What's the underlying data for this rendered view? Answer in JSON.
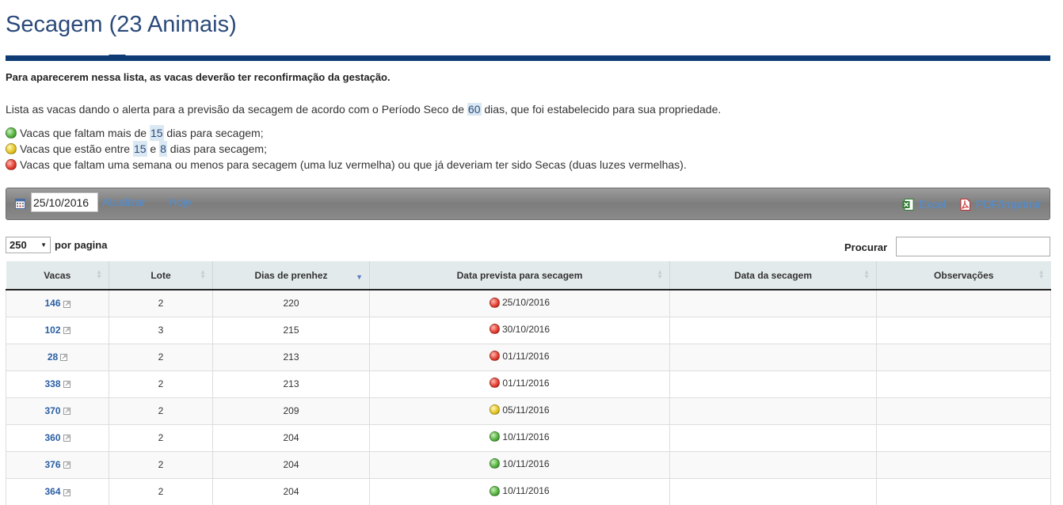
{
  "header": {
    "title": "Secagem (23 Animais)"
  },
  "notice": "Para aparecerem nessa lista, as vacas deverão ter reconfirmação da gestação.",
  "intro": {
    "before": "Lista as vacas dando o alerta para a previsão da secagem de acordo com o Período Seco de",
    "days": "60",
    "after": "dias, que foi estabelecido para sua propriedade."
  },
  "legend": {
    "green": {
      "before": "Vacas que faltam mais de",
      "n1": "15",
      "after": "dias para secagem;"
    },
    "yellow": {
      "before": "Vacas que estão entre",
      "n1": "15",
      "mid": "e",
      "n2": "8",
      "after": "dias para secagem;"
    },
    "red": {
      "text": "Vacas que faltam uma semana ou menos para secagem (uma luz vermelha) ou que já deveriam ter sido Secas (duas luzes vermelhas)."
    }
  },
  "toolbar": {
    "date_value": "25/10/2016",
    "refresh_label": "Atualizar",
    "today_label": "Hoje",
    "excel_label": "Excel",
    "pdf_label": "PDF/Imprimir"
  },
  "table_controls": {
    "per_page_value": "250",
    "per_page_label": "por pagina",
    "search_label": "Procurar",
    "search_value": ""
  },
  "table": {
    "columns": [
      "Vacas",
      "Lote",
      "Dias de prenhez",
      "Data prevista para secagem",
      "Data da secagem",
      "Observações"
    ],
    "rows": [
      {
        "vaca": "146",
        "lote": "2",
        "dias": "220",
        "status": "red",
        "data_prevista": "25/10/2016",
        "data_secagem": "",
        "obs": ""
      },
      {
        "vaca": "102",
        "lote": "3",
        "dias": "215",
        "status": "red",
        "data_prevista": "30/10/2016",
        "data_secagem": "",
        "obs": ""
      },
      {
        "vaca": "28",
        "lote": "2",
        "dias": "213",
        "status": "red",
        "data_prevista": "01/11/2016",
        "data_secagem": "",
        "obs": ""
      },
      {
        "vaca": "338",
        "lote": "2",
        "dias": "213",
        "status": "red",
        "data_prevista": "01/11/2016",
        "data_secagem": "",
        "obs": ""
      },
      {
        "vaca": "370",
        "lote": "2",
        "dias": "209",
        "status": "yellow",
        "data_prevista": "05/11/2016",
        "data_secagem": "",
        "obs": ""
      },
      {
        "vaca": "360",
        "lote": "2",
        "dias": "204",
        "status": "green",
        "data_prevista": "10/11/2016",
        "data_secagem": "",
        "obs": ""
      },
      {
        "vaca": "376",
        "lote": "2",
        "dias": "204",
        "status": "green",
        "data_prevista": "10/11/2016",
        "data_secagem": "",
        "obs": ""
      },
      {
        "vaca": "364",
        "lote": "2",
        "dias": "204",
        "status": "green",
        "data_prevista": "10/11/2016",
        "data_secagem": "",
        "obs": ""
      }
    ]
  },
  "colors": {
    "title": "#2b4a7a",
    "rule": "#0e3b74",
    "link": "#4f8fd6",
    "status_red": "#e03a2c",
    "status_yellow": "#e3c21d",
    "status_green": "#4fae3a"
  }
}
